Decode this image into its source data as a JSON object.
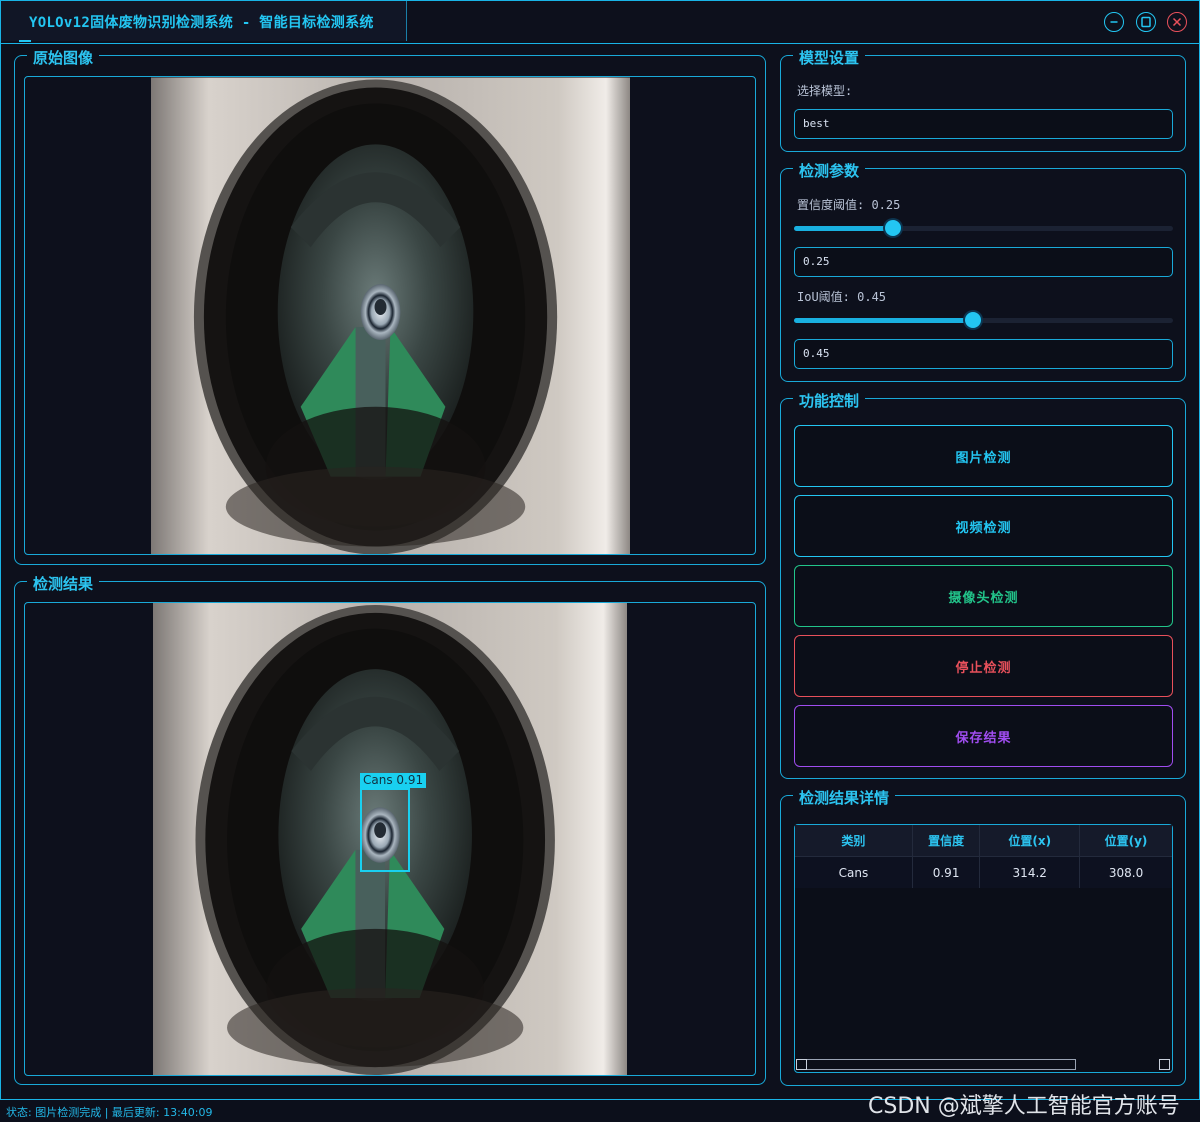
{
  "window": {
    "title": "YOLOv12固体废物识别检测系统 - 智能目标检测系统",
    "accent": "#23c6f2",
    "close_color": "#e8505b"
  },
  "panels": {
    "original_title": "原始图像",
    "result_title": "检测结果"
  },
  "detection_overlay": {
    "label": "Cans",
    "score": "0.91",
    "box_color": "#19d0f0"
  },
  "model": {
    "title": "模型设置",
    "select_label": "选择模型:",
    "selected_model": "best"
  },
  "params": {
    "title": "检测参数",
    "confidence_label": "置信度阈值: 0.25",
    "confidence_value": "0.25",
    "confidence_fraction": 0.25,
    "iou_label": "IoU阈值: 0.45",
    "iou_value": "0.45",
    "iou_fraction": 0.45
  },
  "controls": {
    "title": "功能控制",
    "buttons": [
      {
        "label": "图片检测",
        "color": "#23c6f2"
      },
      {
        "label": "视频检测",
        "color": "#23c6f2"
      },
      {
        "label": "摄像头检测",
        "color": "#22c48a"
      },
      {
        "label": "停止检测",
        "color": "#e8505b"
      },
      {
        "label": "保存结果",
        "color": "#a04df0"
      }
    ]
  },
  "results": {
    "title": "检测结果详情",
    "columns": [
      "类别",
      "置信度",
      "位置(x)",
      "位置(y)"
    ],
    "rows": [
      [
        "Cans",
        "0.91",
        "314.2",
        "308.0"
      ]
    ]
  },
  "status": {
    "text": "状态: 图片检测完成 | 最后更新: 13:40:09"
  },
  "watermark": "CSDN @斌擎人工智能官方账号"
}
